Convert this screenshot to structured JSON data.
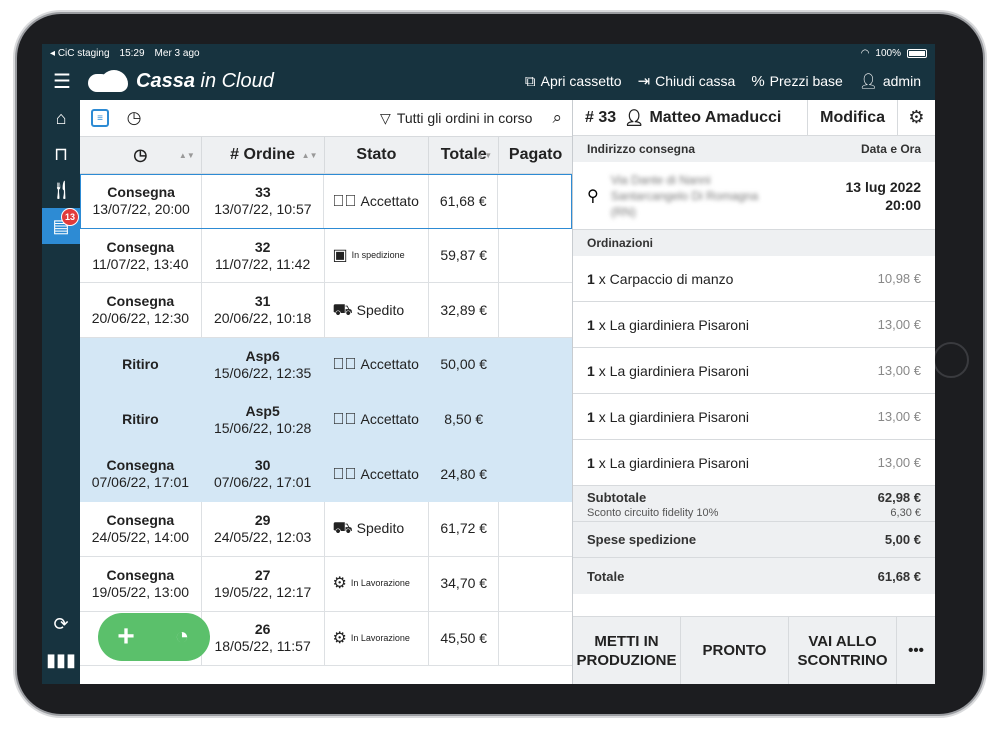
{
  "status": {
    "carrier": "CiC staging",
    "time": "15:29",
    "date": "Mer 3 ago",
    "battery": "100%"
  },
  "topbar": {
    "logo_bold": "Cassa",
    "logo_light": " in Cloud",
    "actions": [
      {
        "label": "Apri cassetto",
        "icon": "open-external-icon"
      },
      {
        "label": "Chiudi cassa",
        "icon": "exit-icon"
      },
      {
        "label": "Prezzi base",
        "icon": "percent-icon"
      },
      {
        "label": "admin",
        "icon": "user-icon"
      }
    ]
  },
  "sidebar": {
    "badge": "13"
  },
  "list": {
    "filter_label": "Tutti gli ordini in corso",
    "columns": [
      "",
      "# Ordine",
      "Stato",
      "Totale",
      "Pagato"
    ],
    "rows": [
      {
        "type": "Consegna",
        "when": "13/07/22, 20:00",
        "num": "33",
        "created": "13/07/22, 10:57",
        "stato": "Accettato",
        "stato_icon": "check-circle-icon",
        "totale": "61,68 €"
      },
      {
        "type": "Consegna",
        "when": "11/07/22, 13:40",
        "num": "32",
        "created": "11/07/22, 11:42",
        "stato": "In spedizione",
        "stato_icon": "package-icon",
        "totale": "59,87 €"
      },
      {
        "type": "Consegna",
        "when": "20/06/22, 12:30",
        "num": "31",
        "created": "20/06/22, 10:18",
        "stato": "Spedito",
        "stato_icon": "truck-icon",
        "totale": "32,89 €"
      },
      {
        "type": "Ritiro",
        "when": "",
        "num": "Asp6",
        "created": "15/06/22, 12:35",
        "stato": "Accettato",
        "stato_icon": "check-circle-icon",
        "totale": "50,00 €"
      },
      {
        "type": "Ritiro",
        "when": "",
        "num": "Asp5",
        "created": "15/06/22, 10:28",
        "stato": "Accettato",
        "stato_icon": "check-circle-icon",
        "totale": "8,50 €"
      },
      {
        "type": "Consegna",
        "when": "07/06/22, 17:01",
        "num": "30",
        "created": "07/06/22, 17:01",
        "stato": "Accettato",
        "stato_icon": "check-circle-icon",
        "totale": "24,80 €"
      },
      {
        "type": "Consegna",
        "when": "24/05/22, 14:00",
        "num": "29",
        "created": "24/05/22, 12:03",
        "stato": "Spedito",
        "stato_icon": "truck-icon",
        "totale": "61,72 €"
      },
      {
        "type": "Consegna",
        "when": "19/05/22, 13:00",
        "num": "27",
        "created": "19/05/22, 12:17",
        "stato": "In Lavorazione",
        "stato_icon": "gear-icon",
        "totale": "34,70 €"
      },
      {
        "type": "",
        "when": "",
        "num": "26",
        "created": "18/05/22, 11:57",
        "stato": "In Lavorazione",
        "stato_icon": "gear-icon",
        "totale": "45,50 €"
      }
    ]
  },
  "detail": {
    "order_num": "# 33",
    "customer": "Matteo Amaducci",
    "edit_label": "Modifica",
    "address_header": "Indirizzo consegna",
    "datetime_header": "Data e Ora",
    "address_lines": [
      "Via Dante di Nanni",
      "Santarcangelo Di Romagna",
      "(RN)"
    ],
    "date": "13 lug 2022",
    "time": "20:00",
    "orders_header": "Ordinazioni",
    "items": [
      {
        "qty": "1",
        "name": "x Carpaccio di manzo",
        "price": "10,98 €"
      },
      {
        "qty": "1",
        "name": "x La giardiniera Pisaroni",
        "price": "13,00 €"
      },
      {
        "qty": "1",
        "name": "x La giardiniera Pisaroni",
        "price": "13,00 €"
      },
      {
        "qty": "1",
        "name": "x La giardiniera Pisaroni",
        "price": "13,00 €"
      },
      {
        "qty": "1",
        "name": "x La giardiniera Pisaroni",
        "price": "13,00 €"
      }
    ],
    "subtotal_label": "Subtotale",
    "subtotal": "62,98 €",
    "discount_label": "Sconto circuito fidelity 10%",
    "discount": "6,30 €",
    "shipping_label": "Spese spedizione",
    "shipping": "5,00 €",
    "total_label": "Totale",
    "total": "61,68 €",
    "buttons": [
      "METTI IN PRODUZIONE",
      "PRONTO",
      "VAI ALLO SCONTRINO",
      "•••"
    ]
  },
  "colors": {
    "navy": "#17333f",
    "accent": "#2d8bd4",
    "highlight": "#d4e7f5",
    "fab": "#5bc06b",
    "badge": "#e13b3b"
  }
}
